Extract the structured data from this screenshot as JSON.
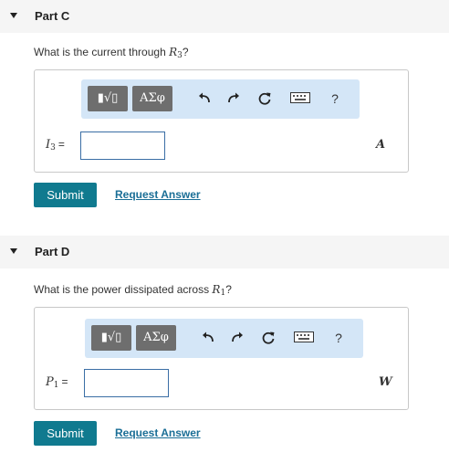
{
  "partC": {
    "title": "Part C",
    "question_prefix": "What is the current through ",
    "question_var": "R",
    "question_sub": "3",
    "question_suffix": "?",
    "var_name": "I",
    "var_sub": "3",
    "equals": "=",
    "input_value": "",
    "unit": "A",
    "submit_label": "Submit",
    "request_label": "Request Answer"
  },
  "partD": {
    "title": "Part D",
    "question_prefix": "What is the power dissipated across ",
    "question_var": "R",
    "question_sub": "1",
    "question_suffix": "?",
    "var_name": "P",
    "var_sub": "1",
    "equals": "=",
    "input_value": "",
    "unit": "W",
    "submit_label": "Submit",
    "request_label": "Request Answer"
  },
  "toolbar": {
    "templates_label": "▮√▯",
    "symbols_label": "ΑΣφ",
    "help_label": "?",
    "icons": [
      "templates-icon",
      "greek-symbols-icon",
      "undo-icon",
      "redo-icon",
      "reset-icon",
      "keyboard-icon",
      "help-icon"
    ]
  },
  "colors": {
    "toolbar_bg": "#d4e6f7",
    "submit_bg": "#107a8f",
    "link": "#1a6e96",
    "input_border": "#3a6ea5"
  }
}
